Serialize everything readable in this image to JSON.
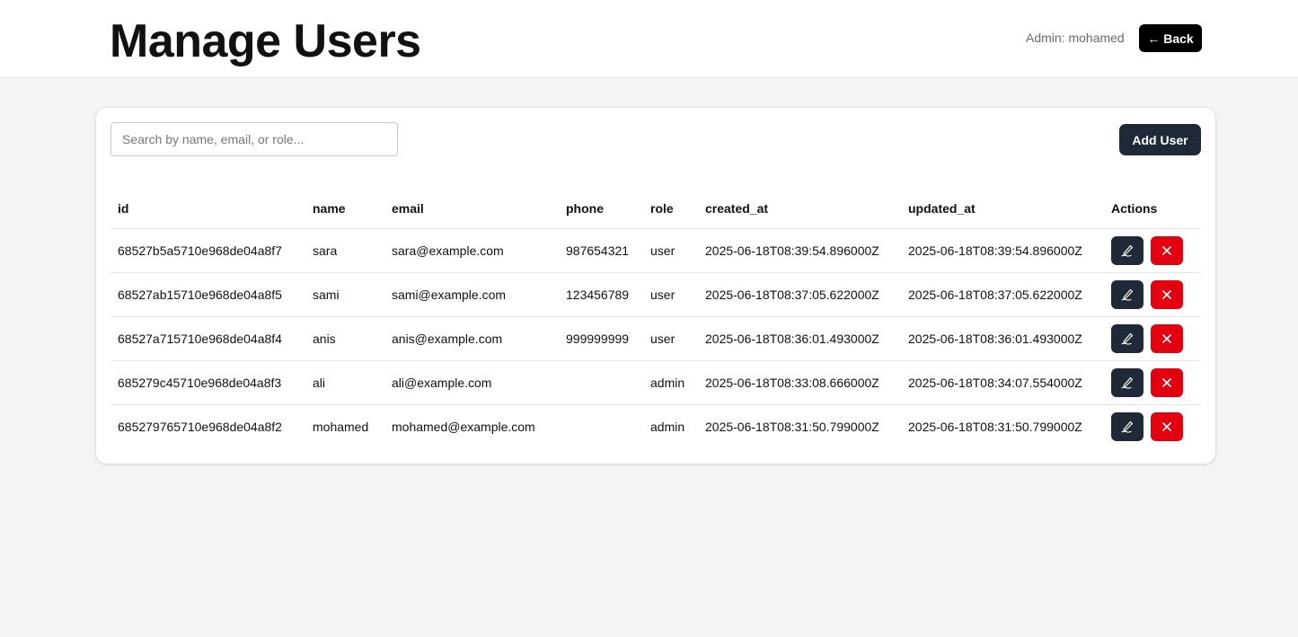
{
  "header": {
    "title": "Manage Users",
    "admin_label": "Admin: mohamed",
    "back_label": "← Back"
  },
  "toolbar": {
    "search_placeholder": "Search by name, email, or role...",
    "add_user_label": "Add User"
  },
  "table": {
    "columns": [
      "id",
      "name",
      "email",
      "phone",
      "role",
      "created_at",
      "updated_at",
      "Actions"
    ],
    "rows": [
      {
        "id": "68527b5a5710e968de04a8f7",
        "name": "sara",
        "email": "sara@example.com",
        "phone": "987654321",
        "role": "user",
        "created_at": "2025-06-18T08:39:54.896000Z",
        "updated_at": "2025-06-18T08:39:54.896000Z"
      },
      {
        "id": "68527ab15710e968de04a8f5",
        "name": "sami",
        "email": "sami@example.com",
        "phone": "123456789",
        "role": "user",
        "created_at": "2025-06-18T08:37:05.622000Z",
        "updated_at": "2025-06-18T08:37:05.622000Z"
      },
      {
        "id": "68527a715710e968de04a8f4",
        "name": "anis",
        "email": "anis@example.com",
        "phone": "999999999",
        "role": "user",
        "created_at": "2025-06-18T08:36:01.493000Z",
        "updated_at": "2025-06-18T08:36:01.493000Z"
      },
      {
        "id": "685279c45710e968de04a8f3",
        "name": "ali",
        "email": "ali@example.com",
        "phone": "",
        "role": "admin",
        "created_at": "2025-06-18T08:33:08.666000Z",
        "updated_at": "2025-06-18T08:34:07.554000Z"
      },
      {
        "id": "685279765710e968de04a8f2",
        "name": "mohamed",
        "email": "mohamed@example.com",
        "phone": "",
        "role": "admin",
        "created_at": "2025-06-18T08:31:50.799000Z",
        "updated_at": "2025-06-18T08:31:50.799000Z"
      }
    ],
    "row_actions": {
      "edit_icon": "signature-pen-icon",
      "delete_icon": "close-x-icon"
    }
  },
  "colors": {
    "page_bg": "#f4f4f4",
    "primary_dark": "#1f2937",
    "danger": "#e3000f",
    "back_button": "#000000"
  }
}
